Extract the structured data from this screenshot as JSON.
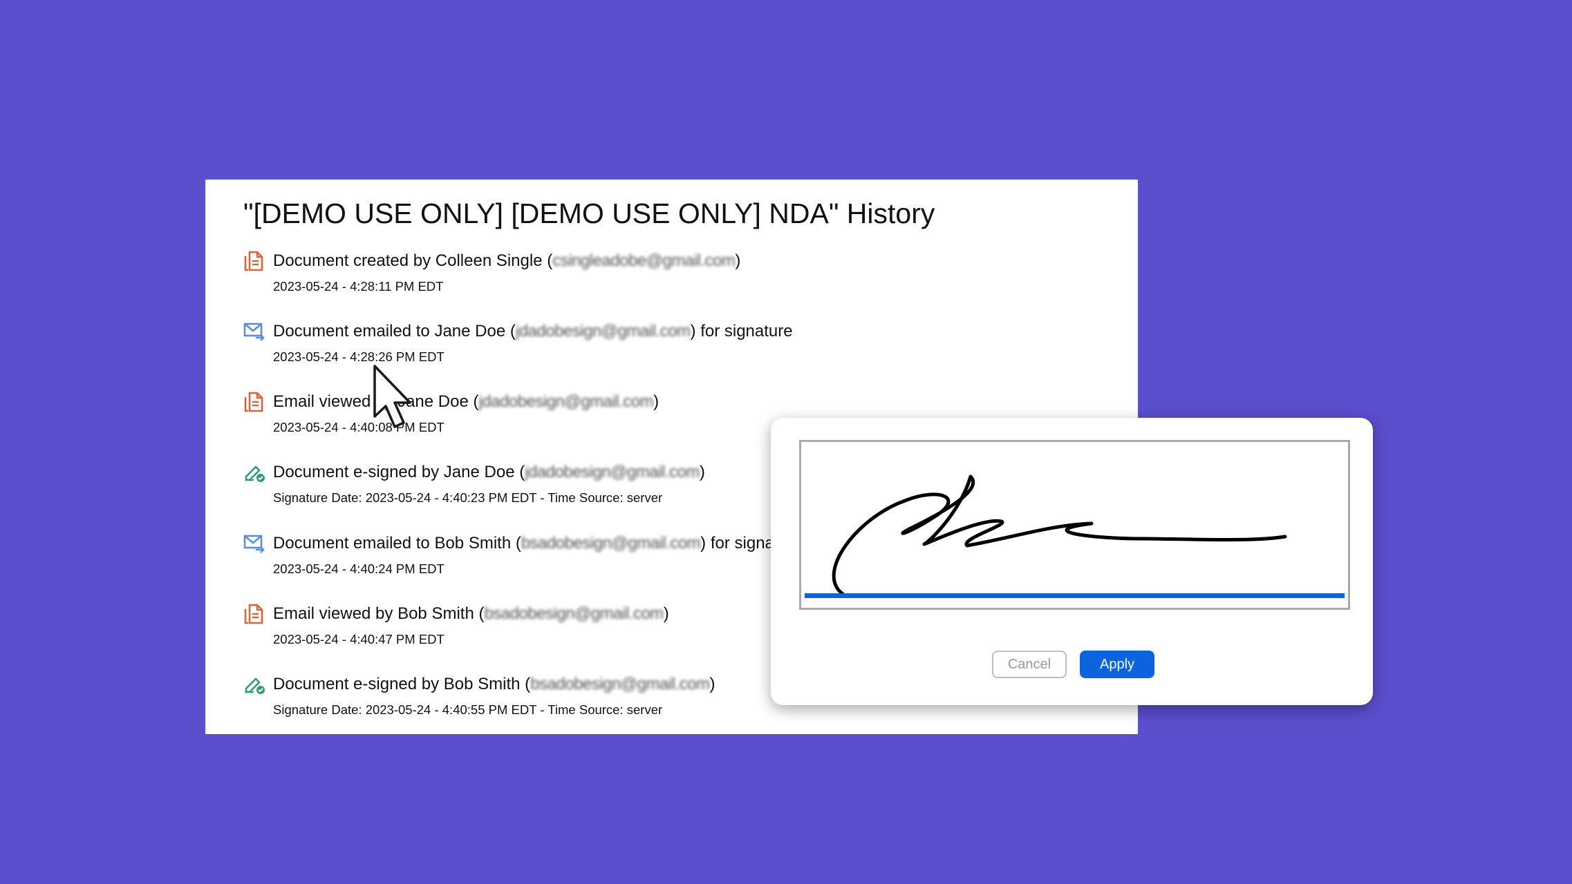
{
  "history": {
    "title": "\"[DEMO USE ONLY] [DEMO USE ONLY] NDA\" History",
    "entries": [
      {
        "icon": "document-icon",
        "main_prefix": "Document created by Colleen Single (",
        "email": "csingleadobe@gmail.com",
        "main_suffix": ")",
        "sub": "2023-05-24 - 4:28:11 PM EDT"
      },
      {
        "icon": "email-send-icon",
        "main_prefix": "Document emailed to Jane Doe (",
        "email": "jdadobesign@gmail.com",
        "main_suffix": ") for signature",
        "sub": "2023-05-24 - 4:28:26 PM EDT"
      },
      {
        "icon": "document-icon",
        "main_prefix": "Email viewed by Jane Doe (",
        "email": "jdadobesign@gmail.com",
        "main_suffix": ")",
        "sub": "2023-05-24 - 4:40:08 PM EDT"
      },
      {
        "icon": "esign-icon",
        "main_prefix": "Document e-signed by Jane Doe (",
        "email": "jdadobesign@gmail.com",
        "main_suffix": ")",
        "sub": "Signature Date: 2023-05-24 - 4:40:23 PM EDT - Time Source: server"
      },
      {
        "icon": "email-send-icon",
        "main_prefix": "Document emailed to Bob Smith (",
        "email": "bsadobesign@gmail.com",
        "main_suffix": ") for signature",
        "sub": "2023-05-24 - 4:40:24 PM EDT"
      },
      {
        "icon": "document-icon",
        "main_prefix": "Email viewed by Bob Smith (",
        "email": "bsadobesign@gmail.com",
        "main_suffix": ")",
        "sub": "2023-05-24 - 4:40:47 PM EDT"
      },
      {
        "icon": "esign-icon",
        "main_prefix": "Document e-signed by Bob Smith (",
        "email": "bsadobesign@gmail.com",
        "main_suffix": ")",
        "sub": "Signature Date: 2023-05-24 - 4:40:55 PM EDT - Time Source: server"
      }
    ]
  },
  "dialog": {
    "cancel_label": "Cancel",
    "apply_label": "Apply"
  },
  "colors": {
    "background": "#5a4fcd",
    "accent_blue": "#0b64dd",
    "document_icon": "#d9643a",
    "email_icon": "#5b8fd6",
    "esign_icon": "#2f9a7e"
  }
}
